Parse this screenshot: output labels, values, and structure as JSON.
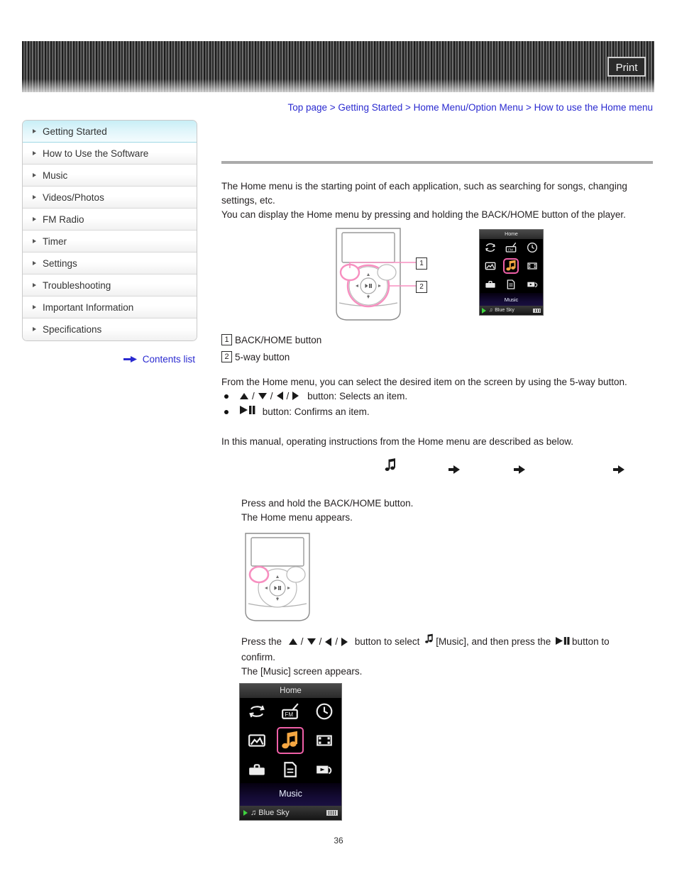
{
  "header": {
    "print_label": "Print"
  },
  "breadcrumb": {
    "items": [
      "Top page",
      "Getting Started",
      "Home Menu/Option Menu",
      "How to use the Home menu"
    ],
    "separator": ">"
  },
  "sidebar": {
    "items": [
      {
        "label": "Getting Started",
        "active": true
      },
      {
        "label": "How to Use the Software",
        "active": false
      },
      {
        "label": "Music",
        "active": false
      },
      {
        "label": "Videos/Photos",
        "active": false
      },
      {
        "label": "FM Radio",
        "active": false
      },
      {
        "label": "Timer",
        "active": false
      },
      {
        "label": "Settings",
        "active": false
      },
      {
        "label": "Troubleshooting",
        "active": false
      },
      {
        "label": "Important Information",
        "active": false
      },
      {
        "label": "Specifications",
        "active": false
      }
    ],
    "contents_link": "Contents list"
  },
  "main": {
    "page_title": "",
    "intro_line1": "The Home menu is the starting point of each application, such as searching for songs, changing",
    "intro_line2": "settings, etc.",
    "intro_line3": "You can display the Home menu by pressing and holding the BACK/HOME button of the player.",
    "legend": [
      {
        "num": "1",
        "label": "BACK/HOME button"
      },
      {
        "num": "2",
        "label": "5-way button"
      }
    ],
    "from_home_text": "From the Home menu, you can select the desired item on the screen by using the 5-way button.",
    "bullets": [
      {
        "suffix": "button: Selects an item."
      },
      {
        "suffix": "button: Confirms an item."
      }
    ],
    "manual_text": "In this manual, operating instructions from the Home menu are described as below.",
    "flow": {
      "note_icon": "music-note-icon",
      "arrow_icon": "arrow-right-icon",
      "label1": "",
      "label2": "",
      "label3": "",
      "label4": ""
    },
    "step1_line1": "Press and hold the BACK/HOME button.",
    "step1_line2": "The Home menu appears.",
    "step2_prefix": "Press the",
    "step2_mid": "button to select",
    "step2_music": "[Music], and then press the",
    "step2_suffix": "button to",
    "step2_line2": "confirm.",
    "step2_line3": "The [Music] screen appears."
  },
  "device_screen": {
    "title": "Home",
    "selected_label": "Music",
    "status_track": "Blue Sky",
    "icons": [
      "recently-played-icon",
      "fm-radio-icon",
      "clock-icon",
      "photo-icon",
      "music-note-icon",
      "video-icon",
      "settings-toolbox-icon",
      "playlist-icon",
      "playback-history-icon"
    ],
    "selected_index": 4
  },
  "player_illustration": {
    "callout1": "1",
    "callout2": "2"
  },
  "footer": {
    "page_number": "36"
  },
  "colors": {
    "link": "#2a2ad0",
    "sidebar_active": "#c8eef6",
    "highlight_pink": "#f060a8",
    "accent_orange": "#f0a040"
  }
}
